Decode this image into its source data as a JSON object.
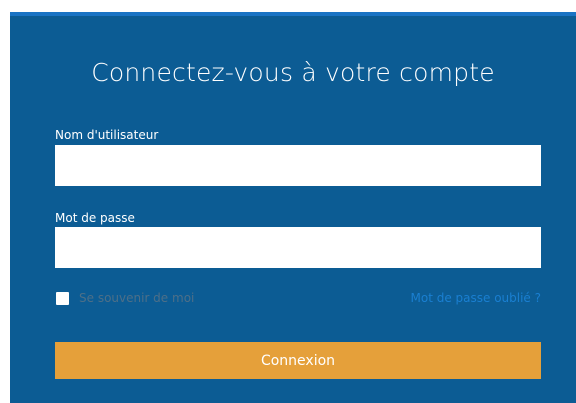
{
  "login": {
    "title": "Connectez-vous à votre compte",
    "username_label": "Nom d'utilisateur",
    "username_value": "",
    "password_label": "Mot de passe",
    "password_value": "",
    "remember_label": "Se souvenir de moi",
    "remember_checked": false,
    "forgot_link": "Mot de passe oublié ?",
    "submit_label": "Connexion"
  },
  "colors": {
    "panel": "#0c5c94",
    "panel_top_border": "#1a73c4",
    "button": "#e5a03a",
    "link": "#1a7fd1",
    "muted_text": "#4d6f88"
  }
}
